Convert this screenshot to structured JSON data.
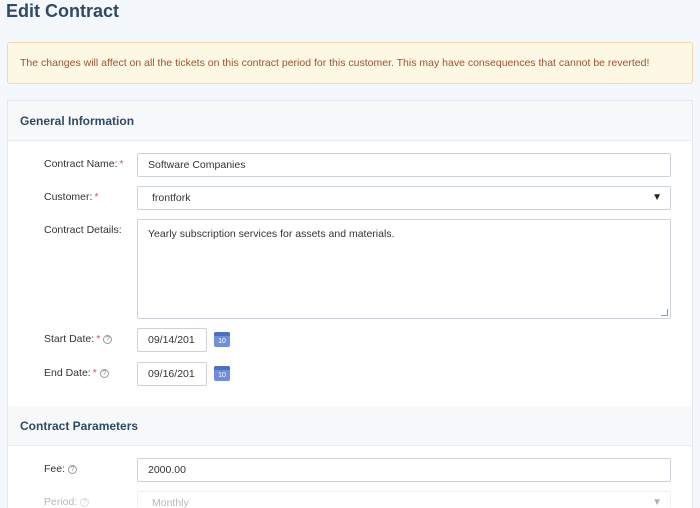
{
  "page": {
    "title": "Edit Contract",
    "warning": "The changes will affect on all the tickets on this contract period for this customer. This may have consequences that cannot be reverted!"
  },
  "general": {
    "header": "General Information",
    "contract_name_label": "Contract Name:",
    "contract_name_value": "Software Companies",
    "customer_label": "Customer:",
    "customer_value": "frontfork",
    "details_label": "Contract Details:",
    "details_value": "Yearly subscription services for assets and materials.",
    "start_label": "Start Date:",
    "start_value": "09/14/201",
    "end_label": "End Date:",
    "end_value": "09/16/201",
    "required_mark": "*",
    "help_glyph": "?",
    "calendar_day": "10"
  },
  "params": {
    "header": "Contract Parameters",
    "fee_label": "Fee:",
    "fee_value": "2000.00",
    "period_label": "Period:",
    "period_value": "Monthly"
  },
  "icons": {
    "select_arrow": "▼"
  },
  "colors": {
    "title": "#2f4a66",
    "warning_bg": "#fcf8e3",
    "warning_text": "#a0522d",
    "required": "#d9534f",
    "calendar": "#6f8fd8"
  }
}
